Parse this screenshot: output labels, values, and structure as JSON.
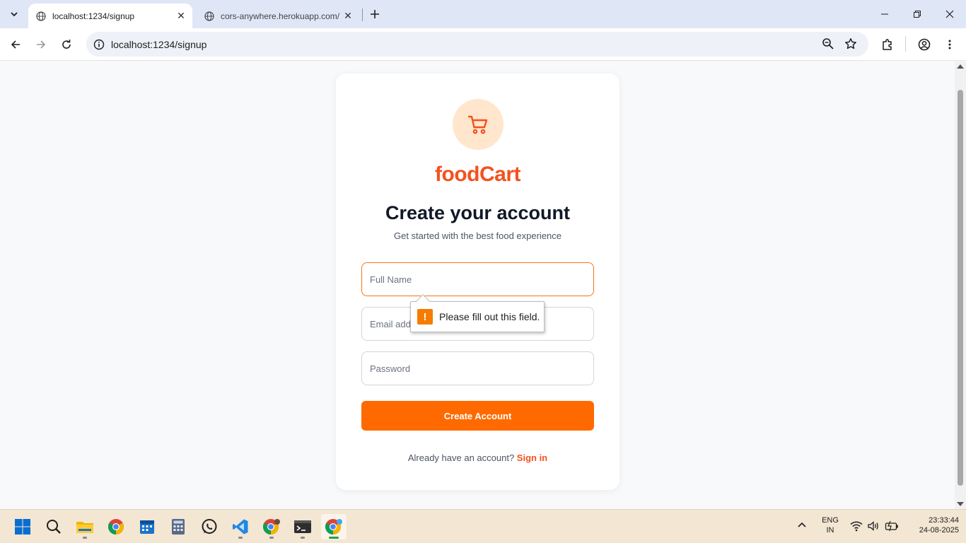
{
  "browser": {
    "tabs": [
      {
        "title": "localhost:1234/signup",
        "active": true
      },
      {
        "title": "cors-anywhere.herokuapp.com/",
        "active": false
      }
    ],
    "url": "localhost:1234/signup"
  },
  "page": {
    "brand": "foodCart",
    "heading": "Create your account",
    "subheading": "Get started with the best food experience",
    "form": {
      "full_name_placeholder": "Full Name",
      "email_placeholder": "Email address",
      "password_placeholder": "Password",
      "submit_label": "Create Account"
    },
    "signin_prompt": "Already have an account?",
    "signin_link": "Sign in",
    "validation_message": "Please fill out this field."
  },
  "taskbar": {
    "apps": [
      "start-icon",
      "search-icon",
      "file-explorer-icon",
      "chrome-icon",
      "calendar-icon",
      "calculator-icon",
      "whatsapp-icon",
      "vscode-icon",
      "chrome-profile-icon",
      "terminal-icon",
      "chrome-active-icon"
    ],
    "lang_primary": "ENG",
    "lang_secondary": "IN",
    "time": "23:33:44",
    "date": "24-08-2025"
  },
  "colors": {
    "accent": "#ff6a00",
    "brand": "#f4511e",
    "logo_bg": "#ffe6cc"
  }
}
